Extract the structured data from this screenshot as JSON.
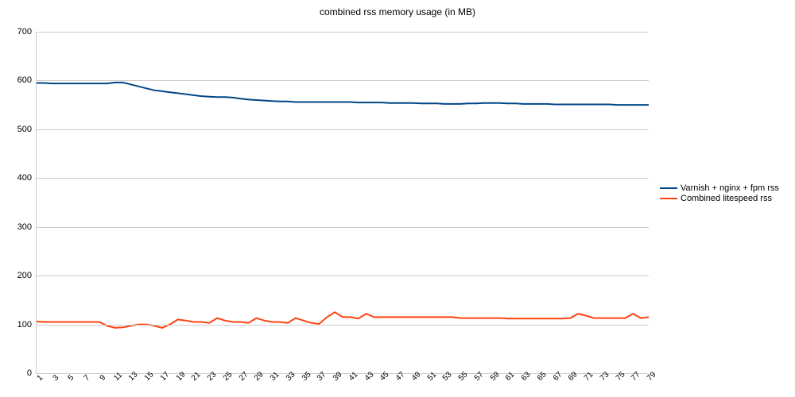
{
  "chart_data": {
    "type": "line",
    "title": "combined rss memory usage (in MB)",
    "xlabel": "",
    "ylabel": "",
    "ylim": [
      0,
      700
    ],
    "yticks": [
      0,
      100,
      200,
      300,
      400,
      500,
      600,
      700
    ],
    "x": [
      1,
      2,
      3,
      4,
      5,
      6,
      7,
      8,
      9,
      10,
      11,
      12,
      13,
      14,
      15,
      16,
      17,
      18,
      19,
      20,
      21,
      22,
      23,
      24,
      25,
      26,
      27,
      28,
      29,
      30,
      31,
      32,
      33,
      34,
      35,
      36,
      37,
      38,
      39,
      40,
      41,
      42,
      43,
      44,
      45,
      46,
      47,
      48,
      49,
      50,
      51,
      52,
      53,
      54,
      55,
      56,
      57,
      58,
      59,
      60,
      61,
      62,
      63,
      64,
      65,
      66,
      67,
      68,
      69,
      70,
      71,
      72,
      73,
      74,
      75,
      76,
      77,
      78,
      79
    ],
    "xticks": [
      1,
      3,
      5,
      7,
      9,
      11,
      13,
      15,
      17,
      19,
      21,
      23,
      25,
      27,
      29,
      31,
      33,
      35,
      37,
      39,
      41,
      43,
      45,
      47,
      49,
      51,
      53,
      55,
      57,
      59,
      61,
      63,
      65,
      67,
      69,
      71,
      73,
      75,
      77,
      79
    ],
    "series": [
      {
        "name": "Varnish + nginx + fpm rss",
        "color": "#004586",
        "values": [
          595,
          595,
          594,
          594,
          594,
          594,
          594,
          594,
          594,
          594,
          596,
          596,
          592,
          588,
          584,
          580,
          578,
          576,
          574,
          572,
          570,
          568,
          567,
          566,
          566,
          565,
          563,
          561,
          560,
          559,
          558,
          557,
          557,
          556,
          556,
          556,
          556,
          556,
          556,
          556,
          556,
          555,
          555,
          555,
          555,
          554,
          554,
          554,
          554,
          553,
          553,
          553,
          552,
          552,
          552,
          553,
          553,
          554,
          554,
          554,
          553,
          553,
          552,
          552,
          552,
          552,
          551,
          551,
          551,
          551,
          551,
          551,
          551,
          551,
          550,
          550,
          550,
          550,
          550
        ]
      },
      {
        "name": "Combined litespeed rss",
        "color": "#ff420e",
        "values": [
          106,
          105,
          105,
          105,
          105,
          105,
          105,
          105,
          105,
          97,
          93,
          94,
          97,
          100,
          100,
          97,
          93,
          100,
          110,
          108,
          105,
          105,
          103,
          113,
          108,
          105,
          105,
          103,
          113,
          108,
          105,
          105,
          103,
          113,
          108,
          103,
          101,
          115,
          125,
          115,
          115,
          112,
          122,
          115,
          115,
          115,
          115,
          115,
          115,
          115,
          115,
          115,
          115,
          115,
          113,
          113,
          113,
          113,
          113,
          113,
          112,
          112,
          112,
          112,
          112,
          112,
          112,
          112,
          113,
          122,
          118,
          113,
          113,
          113,
          113,
          113,
          122,
          113,
          115
        ]
      }
    ]
  }
}
